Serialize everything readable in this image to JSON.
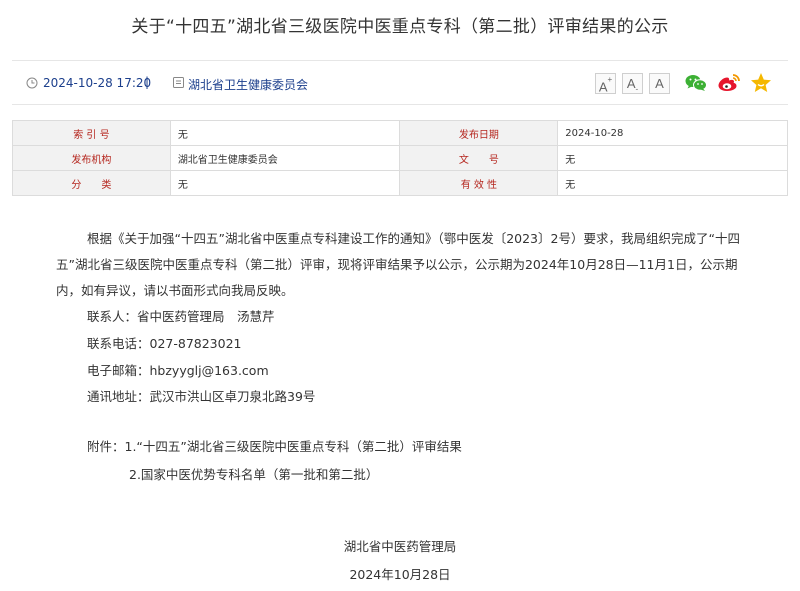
{
  "article": {
    "title": "关于“十四五”湖北省三级医院中医重点专科（第二批）评审结果的公示"
  },
  "meta": {
    "datetime": "2024-10-28 17:20",
    "separator": "|",
    "publisher": "湖北省卫生健康委员会"
  },
  "toolbar": {
    "font_large": "A",
    "font_medium": "A",
    "font_small": "A",
    "icons": [
      "wechat-icon",
      "weibo-icon",
      "favorite-star-icon"
    ],
    "colors": {
      "wechat": "#3cb034",
      "weibo": "#e6162d",
      "star": "#f5b800",
      "link": "#1c3f8c",
      "label": "#b5261e"
    }
  },
  "info_table": {
    "rows": [
      {
        "label1": "索 引 号",
        "value1": "无",
        "label2": "发布日期",
        "value2": "2024-10-28"
      },
      {
        "label1": "发布机构",
        "value1": "湖北省卫生健康委员会",
        "label2": "文　　号",
        "value2": "无"
      },
      {
        "label1": "分　　类",
        "value1": "无",
        "label2": "有 效 性",
        "value2": "无"
      }
    ]
  },
  "body": {
    "paragraph": "根据《关于加强“十四五”湖北省中医重点专科建设工作的通知》（鄂中医发〔2023〕2号）要求，我局组织完成了“十四五”湖北省三级医院中医重点专科（第二批）评审，现将评审结果予以公示，公示期为2024年10月28日—11月1日，公示期内，如有异议，请以书面形式向我局反映。",
    "contact": "联系人：省中医药管理局　汤慧芹",
    "phone": "联系电话：027-87823021",
    "email": "电子邮箱：hbzyyglj@163.com",
    "address": "通讯地址：武汉市洪山区卓刀泉北路39号",
    "attachment1": "附件：1.“十四五”湖北省三级医院中医重点专科（第二批）评审结果",
    "attachment2": "2.国家中医优势专科名单（第一批和第二批）",
    "signature": "湖北省中医药管理局",
    "sign_date": "2024年10月28日"
  }
}
